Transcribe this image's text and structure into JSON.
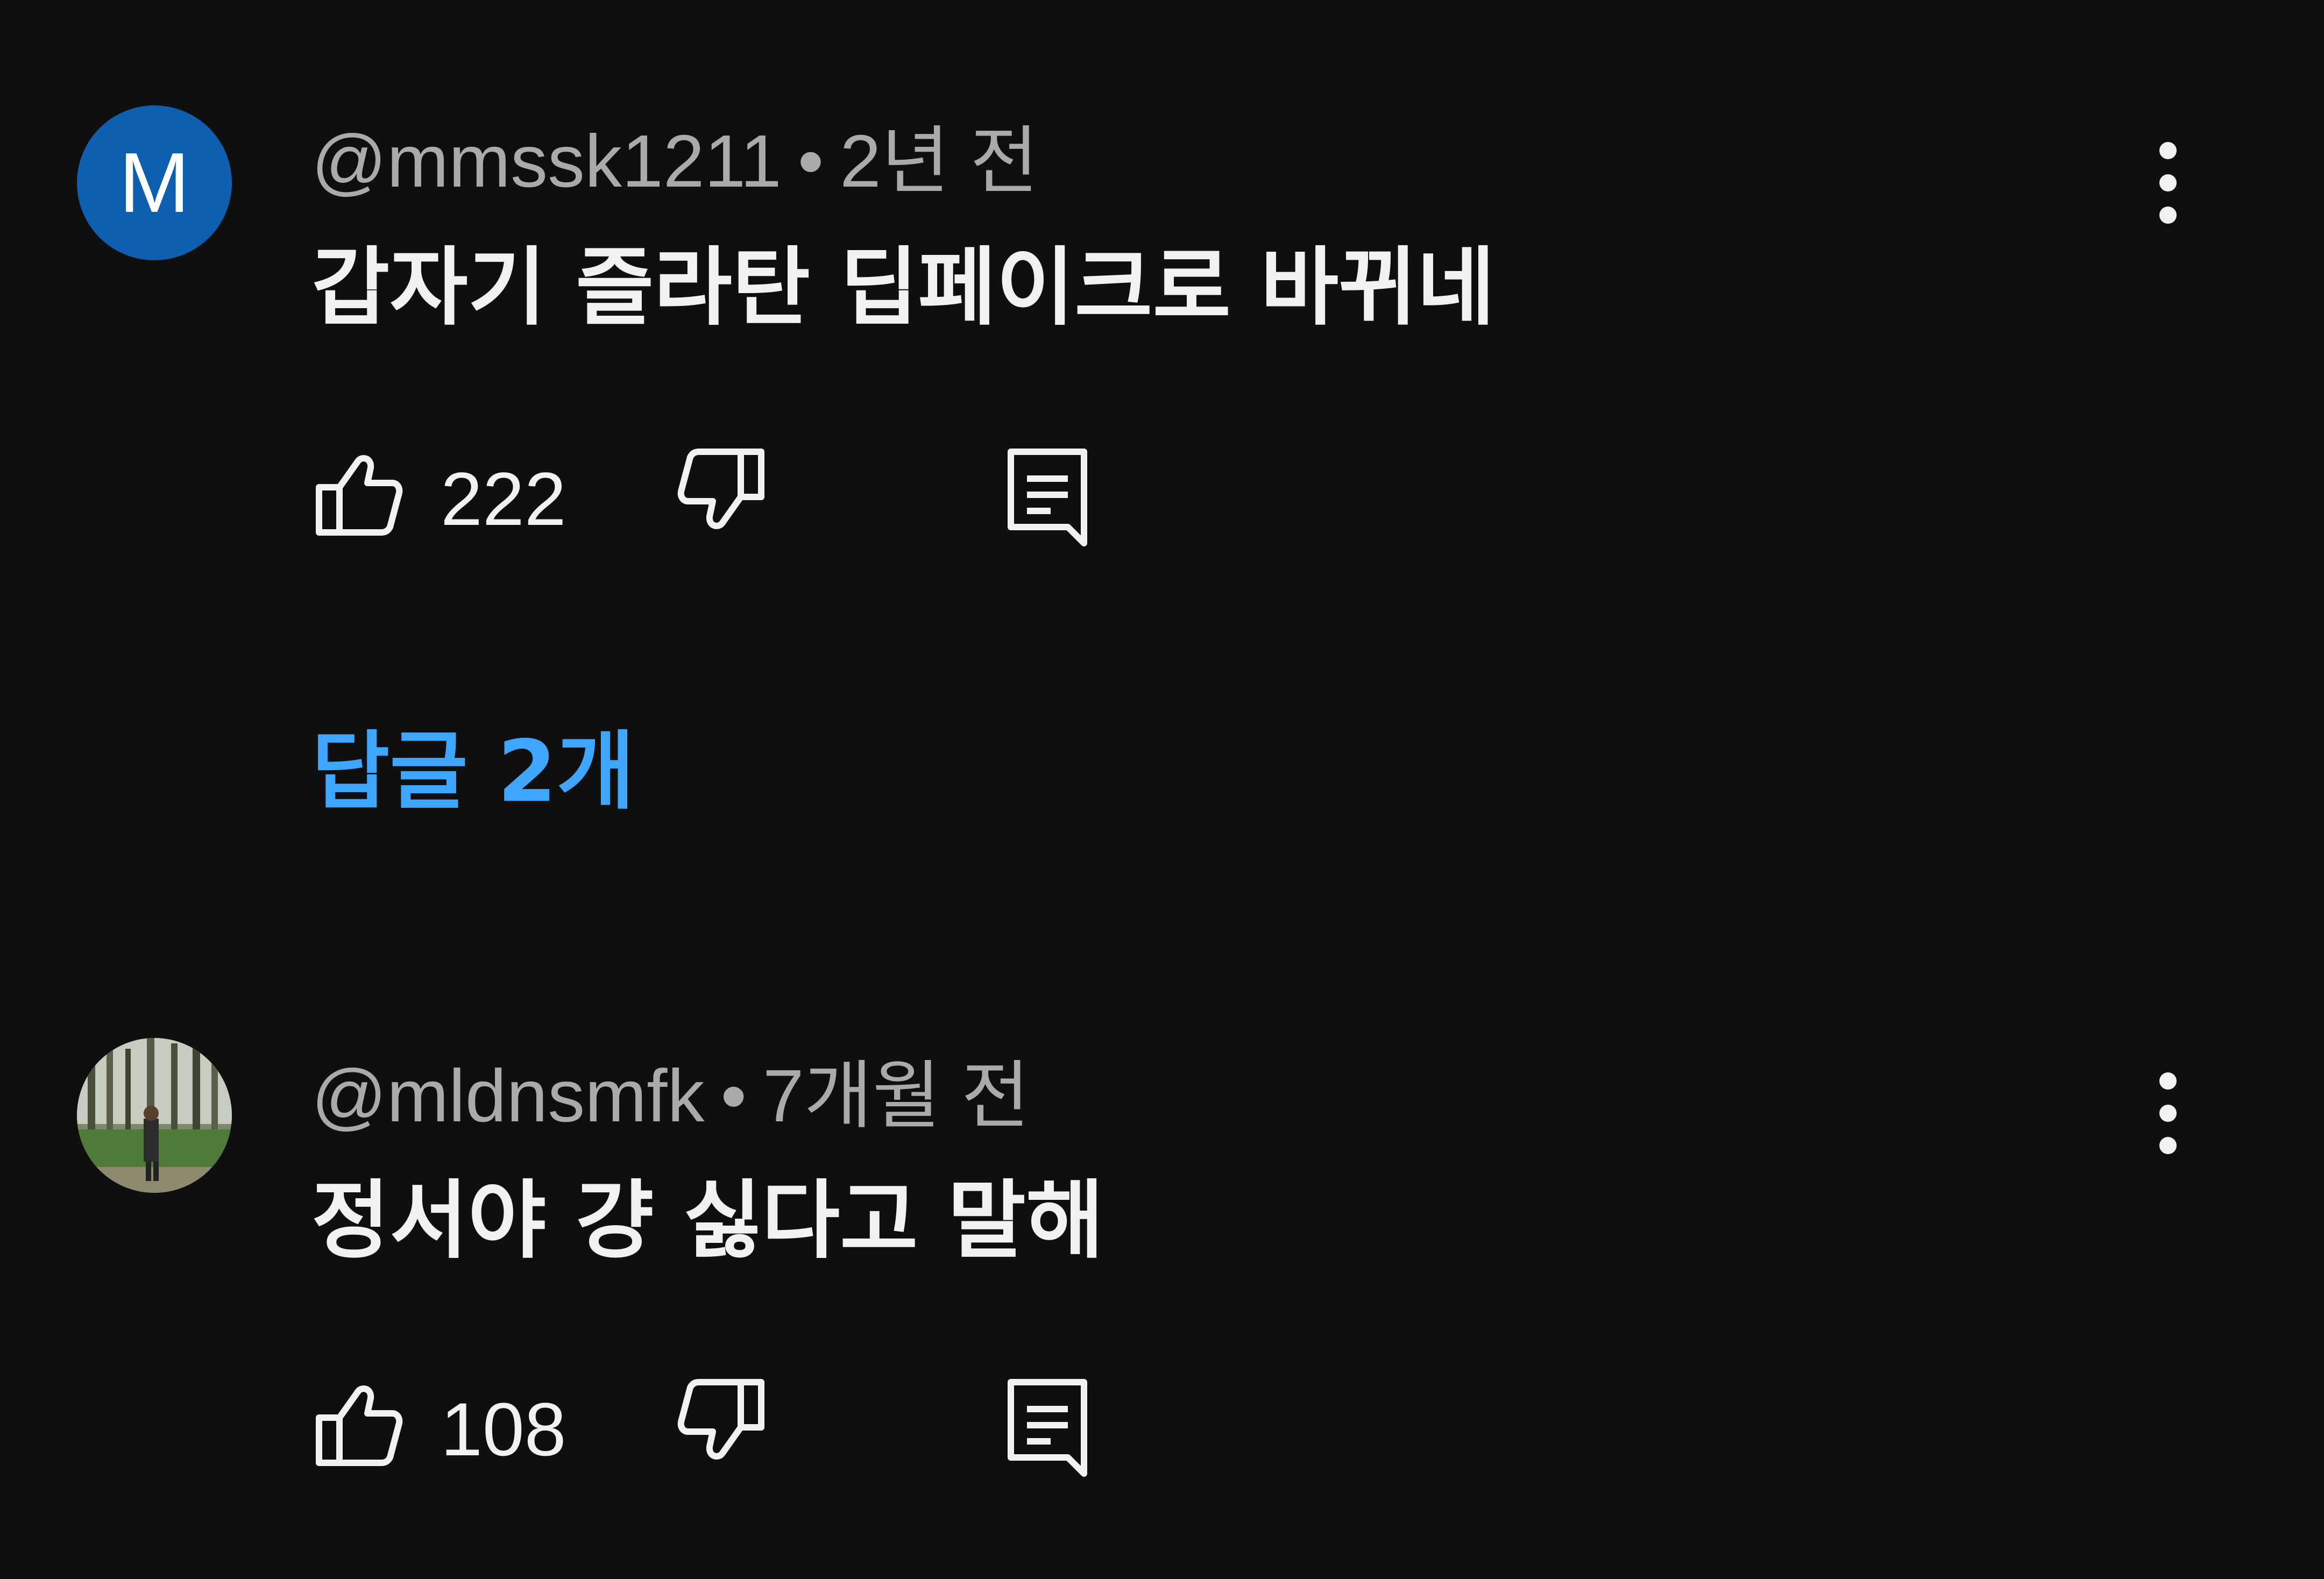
{
  "comments": [
    {
      "avatar_letter": "M",
      "avatar_color": "#0f5fb0",
      "author": "@mmssk1211",
      "separator": "•",
      "time": "2년 전",
      "text": "갑자기 즐라탄 딥페이크로 바뀌네",
      "like_count": "222",
      "replies_label": "답글 2개"
    },
    {
      "author": "@mldnsmfk",
      "separator": "•",
      "time": "7개월 전",
      "text": "정서야 걍 싫다고 말해",
      "like_count": "108"
    }
  ],
  "icons": {
    "like": "thumb-up-icon",
    "dislike": "thumb-down-icon",
    "reply": "reply-icon",
    "more": "more-vertical-icon"
  },
  "colors": {
    "background": "#0f0f0f",
    "link": "#3ea6ff",
    "meta": "#aaaaaa",
    "text": "#f1f1f1"
  }
}
